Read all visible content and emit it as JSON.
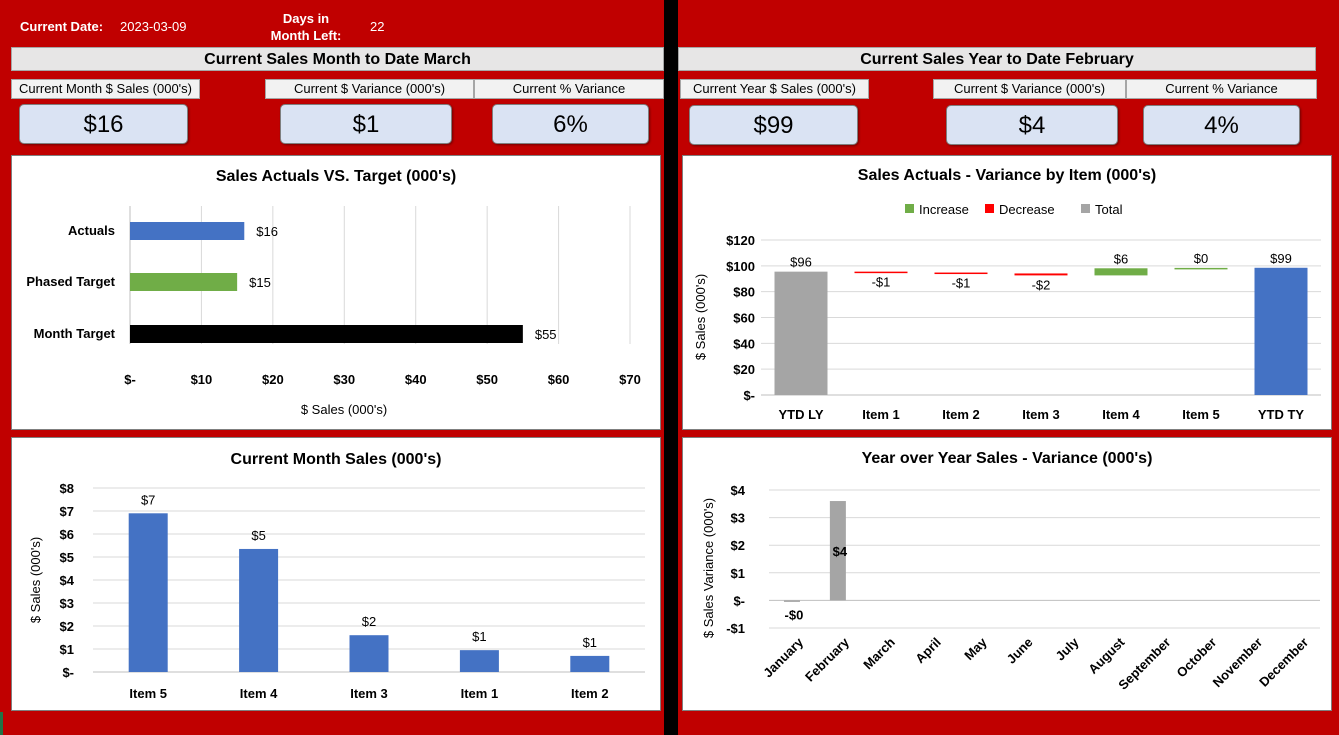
{
  "header": {
    "current_date_label": "Current Date:",
    "current_date": "2023-03-09",
    "days_left_label_1": "Days in",
    "days_left_label_2": "Month Left:",
    "days_left": "22"
  },
  "left": {
    "title": "Current Sales Month to Date March",
    "kpis": [
      {
        "label": "Current Month $ Sales (000's)",
        "value": "$16"
      },
      {
        "label": "Current $ Variance (000's)",
        "value": "$1"
      },
      {
        "label": "Current % Variance",
        "value": "6%"
      }
    ]
  },
  "right": {
    "title": "Current Sales Year to Date February",
    "kpis": [
      {
        "label": "Current Year $ Sales (000's)",
        "value": "$99"
      },
      {
        "label": "Current $ Variance (000's)",
        "value": "$4"
      },
      {
        "label": "Current % Variance",
        "value": "4%"
      }
    ]
  },
  "colors": {
    "blue": "#4472c4",
    "green": "#70ad47",
    "red": "#ff0000",
    "gray": "#a5a5a5",
    "black": "#000000",
    "background": "#c00000"
  },
  "chart_data": [
    {
      "id": "actuals-vs-target",
      "type": "bar",
      "orientation": "horizontal",
      "title": "Sales Actuals VS. Target (000's)",
      "xlabel": "$ Sales (000's)",
      "categories": [
        "Actuals",
        "Phased Target",
        "Month Target"
      ],
      "values": [
        16,
        15,
        55
      ],
      "data_labels": [
        "$16",
        "$15",
        "$55"
      ],
      "bar_colors": [
        "#4472c4",
        "#70ad47",
        "#000000"
      ],
      "xlim": [
        0,
        70
      ],
      "ticks": [
        0,
        10,
        20,
        30,
        40,
        50,
        60,
        70
      ],
      "tick_labels": [
        "$-",
        "$10",
        "$20",
        "$30",
        "$40",
        "$50",
        "$60",
        "$70"
      ],
      "grid": true
    },
    {
      "id": "waterfall",
      "type": "bar",
      "subtype": "waterfall",
      "title": "Sales Actuals - Variance by Item (000's)",
      "ylabel": "$ Sales (000's)",
      "legend": [
        "Increase",
        "Decrease",
        "Total"
      ],
      "legend_colors": [
        "#70ad47",
        "#ff0000",
        "#a5a5a5"
      ],
      "legend_position": "top",
      "categories": [
        "YTD LY",
        "Item 1",
        "Item 2",
        "Item 3",
        "Item 4",
        "Item 5",
        "YTD TY"
      ],
      "values": [
        95.5,
        -0.7,
        -0.7,
        -1.5,
        5.5,
        0.3,
        98.5
      ],
      "kinds": [
        "total",
        "decrease",
        "decrease",
        "decrease",
        "increase",
        "increase",
        "total-ty"
      ],
      "data_labels": [
        "$96",
        "-$1",
        "-$1",
        "-$2",
        "$6",
        "$0",
        "$99"
      ],
      "ylim": [
        0,
        120
      ],
      "ticks": [
        0,
        20,
        40,
        60,
        80,
        100,
        120
      ],
      "tick_labels": [
        "$-",
        "$20",
        "$40",
        "$60",
        "$80",
        "$100",
        "$120"
      ],
      "grid": true
    },
    {
      "id": "month-sales",
      "type": "bar",
      "title": "Current Month Sales (000's)",
      "ylabel": "$ Sales (000's)",
      "categories": [
        "Item 5",
        "Item 4",
        "Item 3",
        "Item 1",
        "Item 2"
      ],
      "values": [
        6.9,
        5.35,
        1.6,
        0.95,
        0.7
      ],
      "data_labels": [
        "$7",
        "$5",
        "$2",
        "$1",
        "$1"
      ],
      "ylim": [
        0,
        8
      ],
      "ticks": [
        0,
        1,
        2,
        3,
        4,
        5,
        6,
        7,
        8
      ],
      "tick_labels": [
        "$-",
        "$1",
        "$2",
        "$3",
        "$4",
        "$5",
        "$6",
        "$7",
        "$8"
      ],
      "grid": true
    },
    {
      "id": "yoy-variance",
      "type": "bar",
      "subtype": "waterfall",
      "title": "Year over Year Sales - Variance (000's)",
      "ylabel": "$ Sales Variance (000's)",
      "categories": [
        "January",
        "February",
        "March",
        "April",
        "May",
        "June",
        "July",
        "August",
        "September",
        "October",
        "November",
        "December"
      ],
      "values": [
        -0.05,
        3.6,
        null,
        null,
        null,
        null,
        null,
        null,
        null,
        null,
        null,
        null
      ],
      "data_labels": [
        "-$0",
        "$4",
        "",
        "",
        "",
        "",
        "",
        "",
        "",
        "",
        "",
        ""
      ],
      "ylim": [
        -1,
        4
      ],
      "ticks": [
        -1,
        0,
        1,
        2,
        3,
        4
      ],
      "tick_labels": [
        "-$1",
        "$-",
        "$1",
        "$2",
        "$3",
        "$4"
      ],
      "grid": true
    }
  ]
}
